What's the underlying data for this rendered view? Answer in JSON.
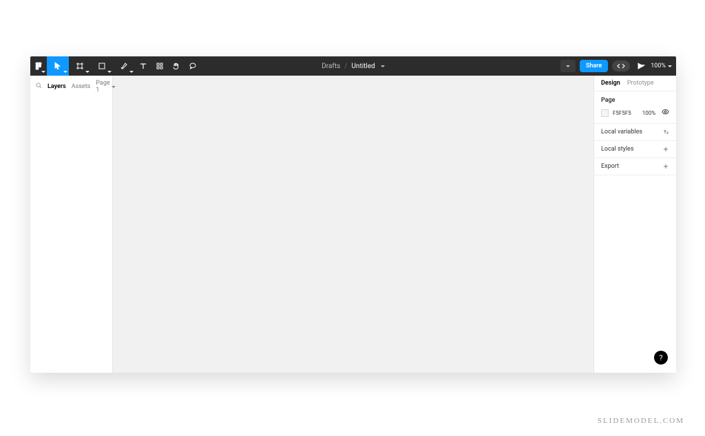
{
  "toolbar": {
    "menu_icon": "figma-menu",
    "tools": [
      {
        "name": "move",
        "icon": "cursor",
        "active": true,
        "dropdown": true
      },
      {
        "name": "frame",
        "icon": "frame",
        "dropdown": true
      },
      {
        "name": "shape",
        "icon": "rect",
        "dropdown": true
      },
      {
        "name": "pen",
        "icon": "pen",
        "dropdown": true
      },
      {
        "name": "text",
        "icon": "text"
      },
      {
        "name": "resources",
        "icon": "grid"
      },
      {
        "name": "hand",
        "icon": "hand"
      },
      {
        "name": "comment",
        "icon": "comment"
      }
    ],
    "breadcrumb": {
      "folder": "Drafts",
      "separator": "/",
      "title": "Untitled"
    },
    "share_label": "Share",
    "zoom_label": "100%"
  },
  "left_panel": {
    "tabs": {
      "layers": "Layers",
      "assets": "Assets"
    },
    "page_label": "Page 1"
  },
  "right_panel": {
    "tabs": {
      "design": "Design",
      "prototype": "Prototype"
    },
    "page_section": {
      "title": "Page",
      "hex": "F5F5F5",
      "opacity": "100%"
    },
    "rows": {
      "local_variables": "Local variables",
      "local_styles": "Local styles",
      "export": "Export"
    }
  },
  "help_label": "?",
  "watermark": "SLIDEMODEL.COM"
}
